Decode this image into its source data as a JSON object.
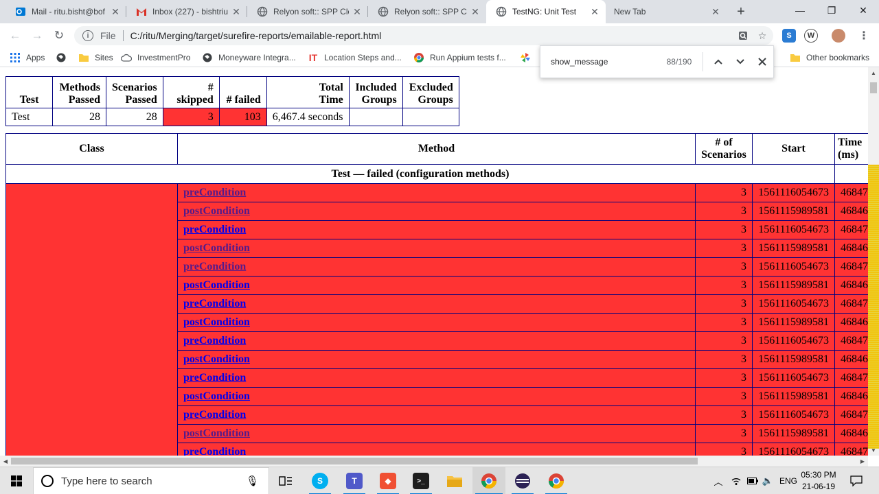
{
  "browser": {
    "tabs": [
      {
        "label": "Mail - ritu.bisht@bof",
        "icon": "outlook-icon",
        "icon_color": "#0078d4",
        "active": false
      },
      {
        "label": "Inbox (227) - bishtriu",
        "icon": "gmail-icon",
        "icon_color": "#d93025",
        "active": false
      },
      {
        "label": "Relyon soft:: SPP Clo",
        "icon": "globe-icon",
        "icon_color": "#5f6368",
        "active": false
      },
      {
        "label": "Relyon soft:: SPP Clo",
        "icon": "globe-icon",
        "icon_color": "#5f6368",
        "active": false
      },
      {
        "label": "TestNG: Unit Test",
        "icon": "globe-icon",
        "icon_color": "#5f6368",
        "active": true
      },
      {
        "label": "New Tab",
        "icon": "",
        "icon_color": "",
        "active": false
      }
    ],
    "address_scheme": "File",
    "address_url": "C:/ritu/Merging/target/surefire-reports/emailable-report.html",
    "bookmarks": [
      {
        "label": "Apps",
        "icon": "apps-grid-icon"
      },
      {
        "label": "",
        "icon": "globe-icon"
      },
      {
        "label": "Sites",
        "icon": "folder-icon"
      },
      {
        "label": "InvestmentPro",
        "icon": "cloud-icon"
      },
      {
        "label": "Moneyware Integra...",
        "icon": "globe-icon"
      },
      {
        "label": "Location Steps and...",
        "icon": "it-logo-icon"
      },
      {
        "label": "Run Appium tests f...",
        "icon": "chrome-store-icon"
      },
      {
        "label": "",
        "icon": "pinwheel-icon"
      }
    ],
    "other_bookmarks": "Other bookmarks",
    "find": {
      "query": "show_message",
      "count": "88/190"
    }
  },
  "report": {
    "summary": {
      "headers": {
        "test": "Test",
        "methods_passed": [
          "Methods",
          "Passed"
        ],
        "scenarios_passed": [
          "Scenarios",
          "Passed"
        ],
        "skipped": "# skipped",
        "failed": "# failed",
        "total_time": [
          "Total",
          "Time"
        ],
        "included_groups": [
          "Included",
          "Groups"
        ],
        "excluded_groups": [
          "Excluded",
          "Groups"
        ]
      },
      "row": {
        "test": "Test",
        "methods_passed": "28",
        "scenarios_passed": "28",
        "skipped": "3",
        "failed": "103",
        "total_time": "6,467.4 seconds",
        "included_groups": "",
        "excluded_groups": ""
      }
    },
    "detail": {
      "headers": {
        "class": "Class",
        "method": "Method",
        "scenarios": [
          "# of",
          "Scenarios"
        ],
        "start": "Start",
        "time": [
          "Time",
          "(ms)"
        ]
      },
      "group_title": "Test — failed (configuration methods)",
      "rows": [
        {
          "method": "preCondition",
          "scenarios": "3",
          "start": "1561116054673",
          "time": "46847",
          "visited": true
        },
        {
          "method": "postCondition",
          "scenarios": "3",
          "start": "1561115989581",
          "time": "46846",
          "visited": true
        },
        {
          "method": "preCondition",
          "scenarios": "3",
          "start": "1561116054673",
          "time": "46847",
          "visited": false
        },
        {
          "method": "postCondition",
          "scenarios": "3",
          "start": "1561115989581",
          "time": "46846",
          "visited": true
        },
        {
          "method": "preCondition",
          "scenarios": "3",
          "start": "1561116054673",
          "time": "46847",
          "visited": true
        },
        {
          "method": "postCondition",
          "scenarios": "3",
          "start": "1561115989581",
          "time": "46846",
          "visited": false
        },
        {
          "method": "preCondition",
          "scenarios": "3",
          "start": "1561116054673",
          "time": "46847",
          "visited": false
        },
        {
          "method": "postCondition",
          "scenarios": "3",
          "start": "1561115989581",
          "time": "46846",
          "visited": false
        },
        {
          "method": "preCondition",
          "scenarios": "3",
          "start": "1561116054673",
          "time": "46847",
          "visited": false
        },
        {
          "method": "postCondition",
          "scenarios": "3",
          "start": "1561115989581",
          "time": "46846",
          "visited": false
        },
        {
          "method": "preCondition",
          "scenarios": "3",
          "start": "1561116054673",
          "time": "46847",
          "visited": false
        },
        {
          "method": "postCondition",
          "scenarios": "3",
          "start": "1561115989581",
          "time": "46846",
          "visited": false
        },
        {
          "method": "preCondition",
          "scenarios": "3",
          "start": "1561116054673",
          "time": "46847",
          "visited": false
        },
        {
          "method": "postCondition",
          "scenarios": "3",
          "start": "1561115989581",
          "time": "46846",
          "visited": true
        },
        {
          "method": "preCondition",
          "scenarios": "3",
          "start": "1561116054673",
          "time": "46847",
          "visited": false
        }
      ]
    },
    "attention_color": "#ff3333",
    "border_color": "#000080"
  },
  "taskbar": {
    "search_placeholder": "Type here to search",
    "apps": [
      "task-view-icon",
      "skype-icon",
      "teams-icon",
      "git-icon",
      "terminal-icon",
      "file-explorer-icon",
      "chrome-icon",
      "eclipse-icon",
      "chrome-icon"
    ],
    "language": "ENG",
    "time": "05:30 PM",
    "date": "21-06-19"
  }
}
